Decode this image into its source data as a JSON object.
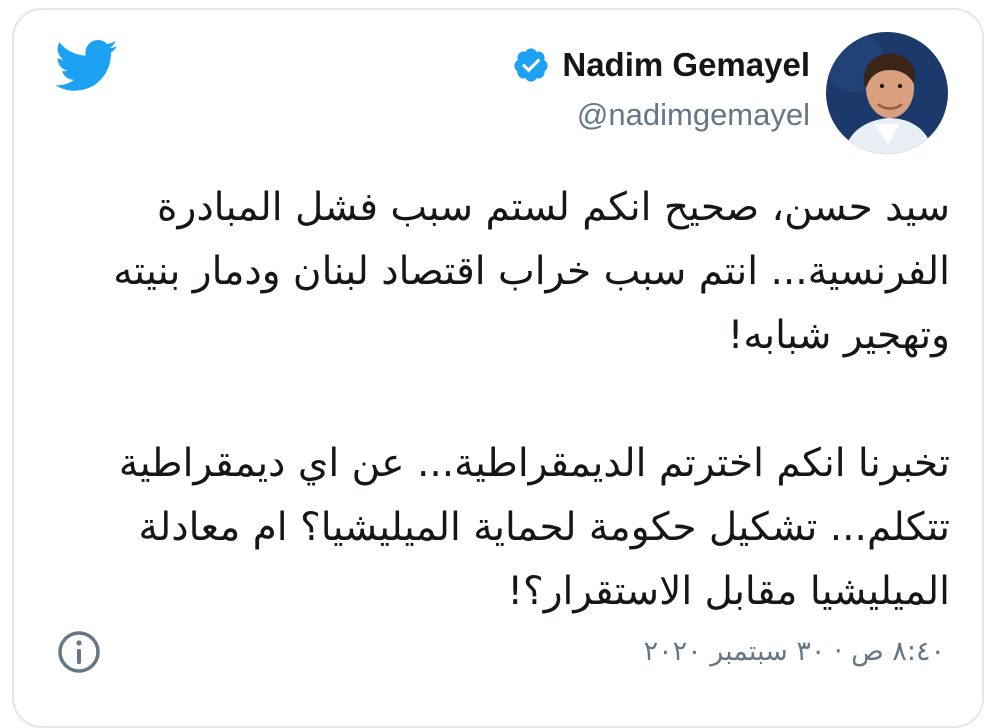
{
  "tweet": {
    "author": {
      "name": "Nadim Gemayel",
      "handle": "@nadimgemayel",
      "verified": true
    },
    "text_lines": [
      "سيد حسن، صحيح انكم لستم سبب فشل المبادرة",
      "الفرنسية... انتم سبب خراب اقتصاد لبنان ودمار بنيته",
      "وتهجير شبابه!",
      "",
      "تخبرنا انكم اخترتم الديمقراطية... عن اي ديمقراطية",
      "تتكلم... تشكيل حكومة لحماية الميليشيا؟ ام معادلة",
      "الميليشيا مقابل الاستقرار؟!"
    ],
    "timestamp": "٨:٤٠ ص · ٣٠ سبتمبر ٢٠٢٠"
  },
  "icons": {
    "brand": "twitter-bird-icon",
    "verified": "verified-badge-icon",
    "info": "info-icon"
  },
  "colors": {
    "brand": "#1da1f2",
    "text": "#14171a",
    "secondary": "#657786",
    "border": "#e3e7ea"
  }
}
